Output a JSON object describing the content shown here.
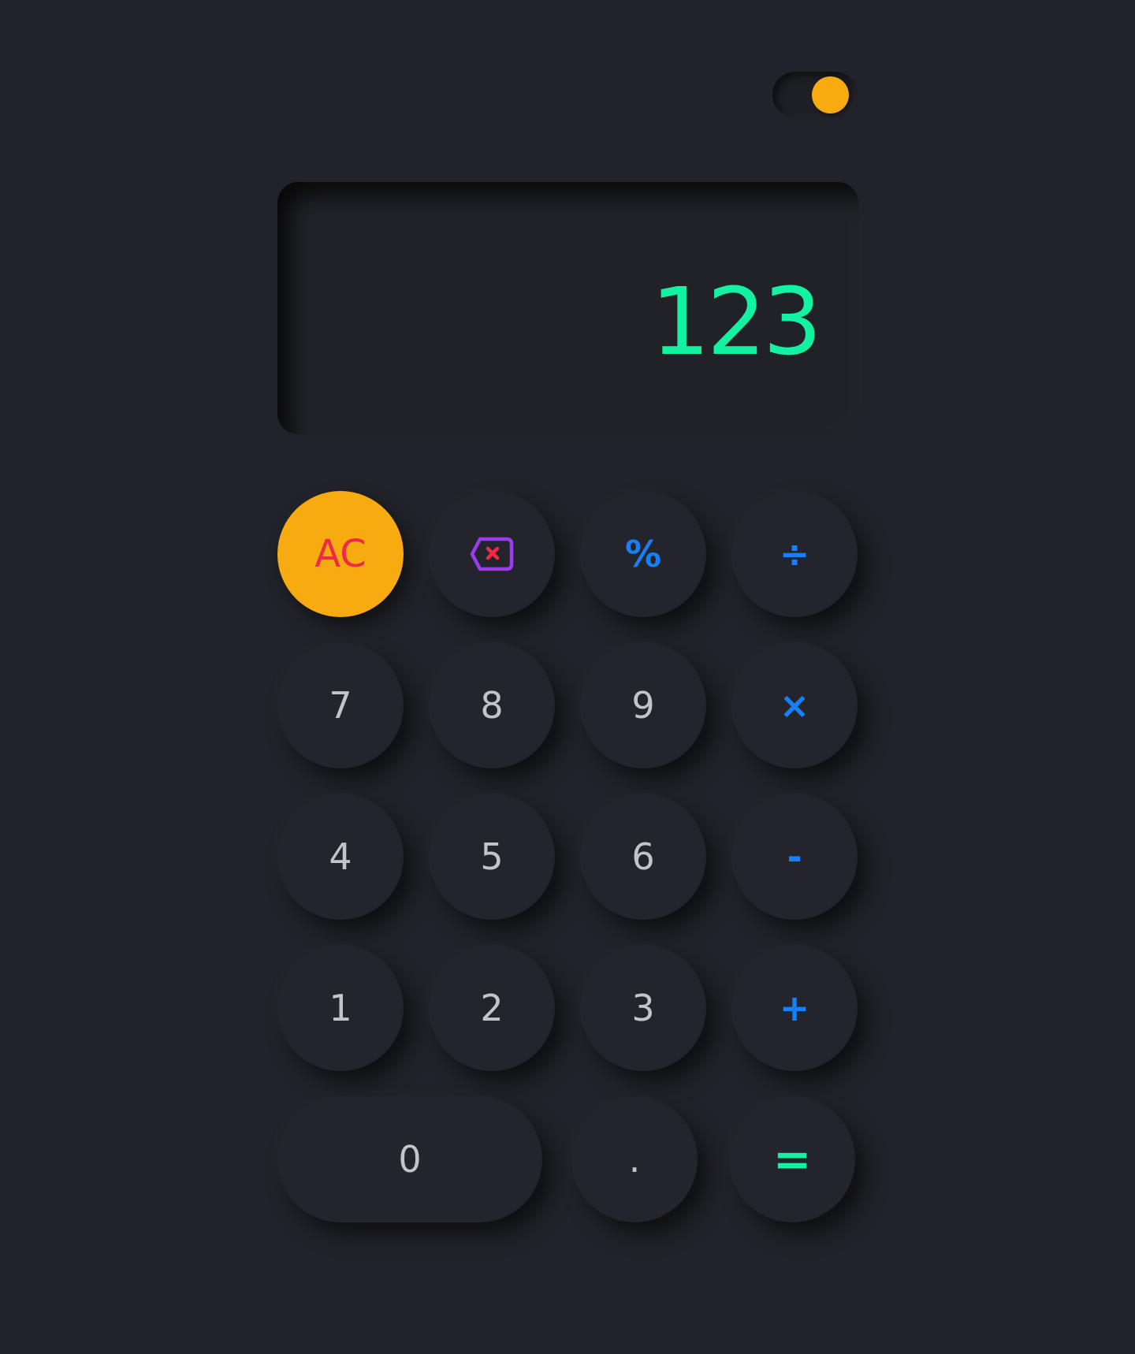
{
  "theme_toggle": {
    "state": "on"
  },
  "display": {
    "value": "123"
  },
  "colors": {
    "background": "#22232a",
    "accent_yellow": "#f8ab11",
    "result_green": "#12f2a0",
    "operator_blue": "#1780f6",
    "clear_red": "#ef2a45",
    "backspace_purple": "#9b3cf0",
    "digit_gray": "#c3c4c9"
  },
  "keys": {
    "ac": "AC",
    "backspace": {
      "icon": "backspace-icon"
    },
    "percent": "%",
    "divide": "÷",
    "seven": "7",
    "eight": "8",
    "nine": "9",
    "multiply": "×",
    "four": "4",
    "five": "5",
    "six": "6",
    "minus": "-",
    "one": "1",
    "two": "2",
    "three": "3",
    "plus": "+",
    "zero": "0",
    "decimal": ".",
    "equals": "="
  }
}
